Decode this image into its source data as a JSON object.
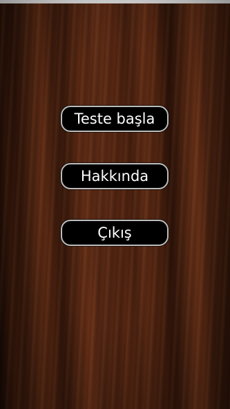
{
  "menu": {
    "start_label": "Teste başla",
    "about_label": "Hakkında",
    "exit_label": "Çıkış"
  },
  "colors": {
    "button_background": "#000000",
    "button_border": "#bdbdbd",
    "button_text": "#ffffff",
    "wood_dark": "#2a1208",
    "wood_light": "#6b3319"
  }
}
